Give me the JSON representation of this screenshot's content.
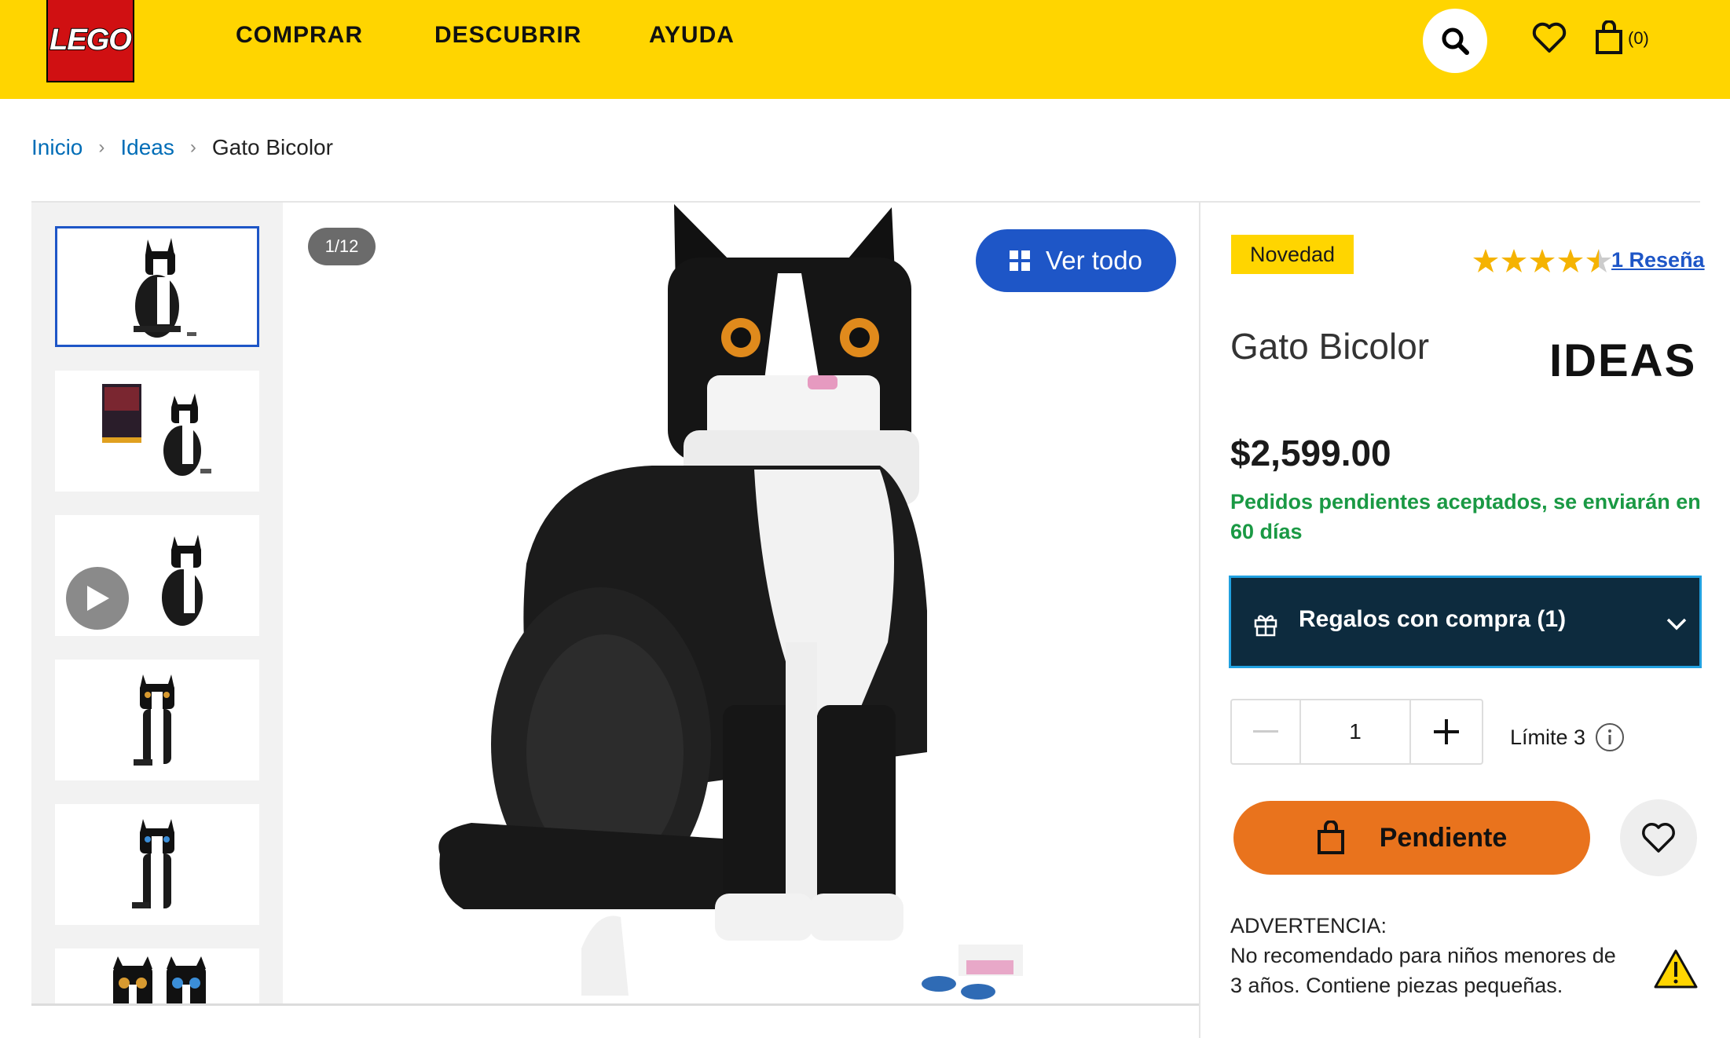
{
  "header": {
    "logo_text": "LEGO",
    "nav": [
      "COMPRAR",
      "DESCUBRIR",
      "AYUDA"
    ],
    "cart_count": "(0)",
    "icons": [
      "search-icon",
      "heart-icon",
      "shopping-bag-icon"
    ]
  },
  "breadcrumb": {
    "home": "Inicio",
    "category": "Ideas",
    "current": "Gato Bicolor"
  },
  "gallery": {
    "counter": "1/12",
    "view_all": "Ver todo",
    "thumbnails": [
      "Set completo",
      "Caja y set",
      "Video",
      "Vista frontal",
      "Variante ojos azules",
      "Cabezas"
    ]
  },
  "product": {
    "badge": "Novedad",
    "rating": 4.5,
    "reviews": "1 Reseña",
    "title": "Gato Bicolor",
    "theme_logo": "IDEAS",
    "price": "$2,599.00",
    "availability": "Pedidos pendientes aceptados, se enviarán en 60 días",
    "gifts": "Regalos con compra (1)",
    "quantity": "1",
    "limit": "Límite 3",
    "cta": "Pendiente",
    "warning_title": "ADVERTENCIA:",
    "warning_text": "No recomendado para niños menores de 3 años. Contiene piezas pequeñas."
  },
  "colors": {
    "header": "#ffd500",
    "lego_red": "#d01012",
    "link_blue": "#006db7",
    "button_blue": "#1e56c7",
    "cta_orange": "#e9731d",
    "gifts_bg": "#0d2b3e",
    "green": "#1a9944"
  }
}
